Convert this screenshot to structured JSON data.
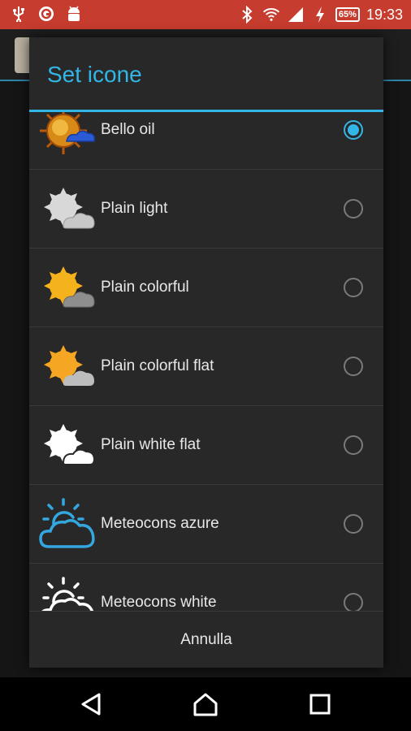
{
  "status_bar": {
    "battery": "65%",
    "time": "19:33",
    "icons": [
      "usb-icon",
      "sync-icon",
      "android-icon",
      "bluetooth-icon",
      "wifi-icon",
      "signal-icon",
      "charging-icon",
      "battery-icon"
    ]
  },
  "dialog": {
    "title": "Set icone",
    "accent_color": "#33b5e5",
    "items": [
      {
        "label": "Bello oil",
        "selected": true,
        "icon": "sun-cloud-icon"
      },
      {
        "label": "Plain light",
        "selected": false,
        "icon": "sun-cloud-icon"
      },
      {
        "label": "Plain colorful",
        "selected": false,
        "icon": "sun-cloud-icon"
      },
      {
        "label": "Plain colorful flat",
        "selected": false,
        "icon": "sun-cloud-icon"
      },
      {
        "label": "Plain white flat",
        "selected": false,
        "icon": "sun-cloud-icon"
      },
      {
        "label": "Meteocons azure",
        "selected": false,
        "icon": "sun-cloud-outline-icon"
      },
      {
        "label": "Meteocons white",
        "selected": false,
        "icon": "sun-cloud-outline-icon"
      }
    ],
    "cancel_label": "Annulla"
  },
  "nav_bar": {
    "buttons": [
      "back-icon",
      "home-icon",
      "recents-icon"
    ]
  }
}
